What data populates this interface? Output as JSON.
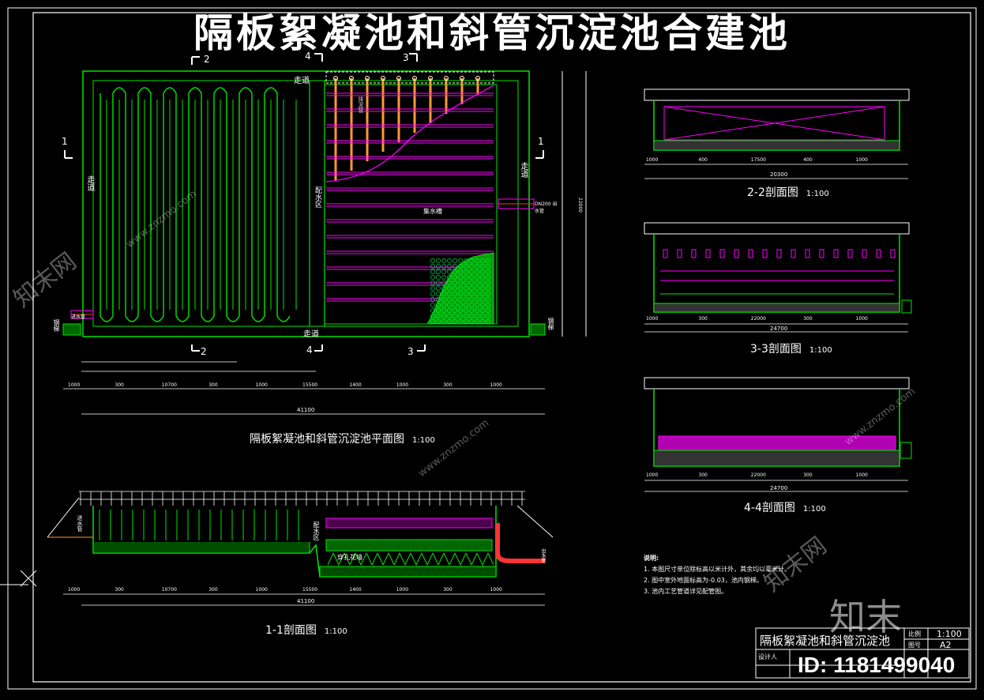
{
  "title": "隔板絮凝池和斜管沉淀池合建池",
  "plan": {
    "caption": "隔板絮凝池和斜管沉淀池平面图",
    "scale": "1:100",
    "walkway_top": "走道",
    "walkway_bottom": "走道",
    "walkway_left": "走道",
    "walkway_right": "走道",
    "distribution_zone": "配水区",
    "collecting_trough": "集水槽",
    "sludge_pipe": "排泥管",
    "inlet_label": "进水管",
    "outlet_label": "DN200 出水管",
    "stairs_left": "钢梯",
    "stairs_right": "钢梯",
    "section_marks": [
      "1",
      "1",
      "2",
      "2",
      "3",
      "3",
      "4",
      "4"
    ],
    "dims_row3": [
      "1000",
      "300",
      "10700",
      "300",
      "1000",
      "15500",
      "1400",
      "1000",
      "300",
      "1000"
    ],
    "total_length": "41100",
    "total_width": "22000"
  },
  "sec11": {
    "caption": "1-1剖面图",
    "scale": "1:100",
    "inlet": "进水管",
    "distribution": "配水区",
    "perforated": "穿孔花墙",
    "outlet": "出水管",
    "dims": [
      "1000",
      "300",
      "10700",
      "300",
      "1000",
      "15500",
      "1400",
      "1000",
      "300",
      "1000"
    ],
    "total": "41100"
  },
  "sec22": {
    "caption": "2-2剖面图",
    "scale": "1:100",
    "dims": [
      "1000",
      "400",
      "17500",
      "400",
      "1000"
    ],
    "total": "20300"
  },
  "sec33": {
    "caption": "3-3剖面图",
    "scale": "1:100",
    "dims": [
      "1000",
      "300",
      "22000",
      "300",
      "1000"
    ],
    "total": "24700"
  },
  "sec44": {
    "caption": "4-4剖面图",
    "scale": "1:100",
    "dims": [
      "1000",
      "300",
      "22000",
      "300",
      "1000"
    ],
    "total": "24700"
  },
  "notes": {
    "heading": "说明:",
    "items": [
      "1. 本图尺寸单位除标高以米计外，其余均以毫米计。",
      "2. 图中室外地面标高为-0.03，池内钢梯。",
      "3. 池内工艺管道详见配管图。"
    ]
  },
  "title_block": {
    "drawing_name": "隔板絮凝池和斜管沉淀池",
    "scale_label": "比例",
    "scale": "1:100",
    "sheet_label": "图号",
    "sheet": "A2",
    "designer_label": "设计人"
  },
  "watermark": {
    "site": "www.znzmo.com",
    "brand_cn": "知末网",
    "logo": "知末",
    "id": "ID: 1181499040"
  },
  "colors": {
    "green": "#00e600",
    "magenta": "#ff00ff",
    "orange": "#ff9933",
    "white": "#ffffff",
    "bg": "#000000"
  }
}
